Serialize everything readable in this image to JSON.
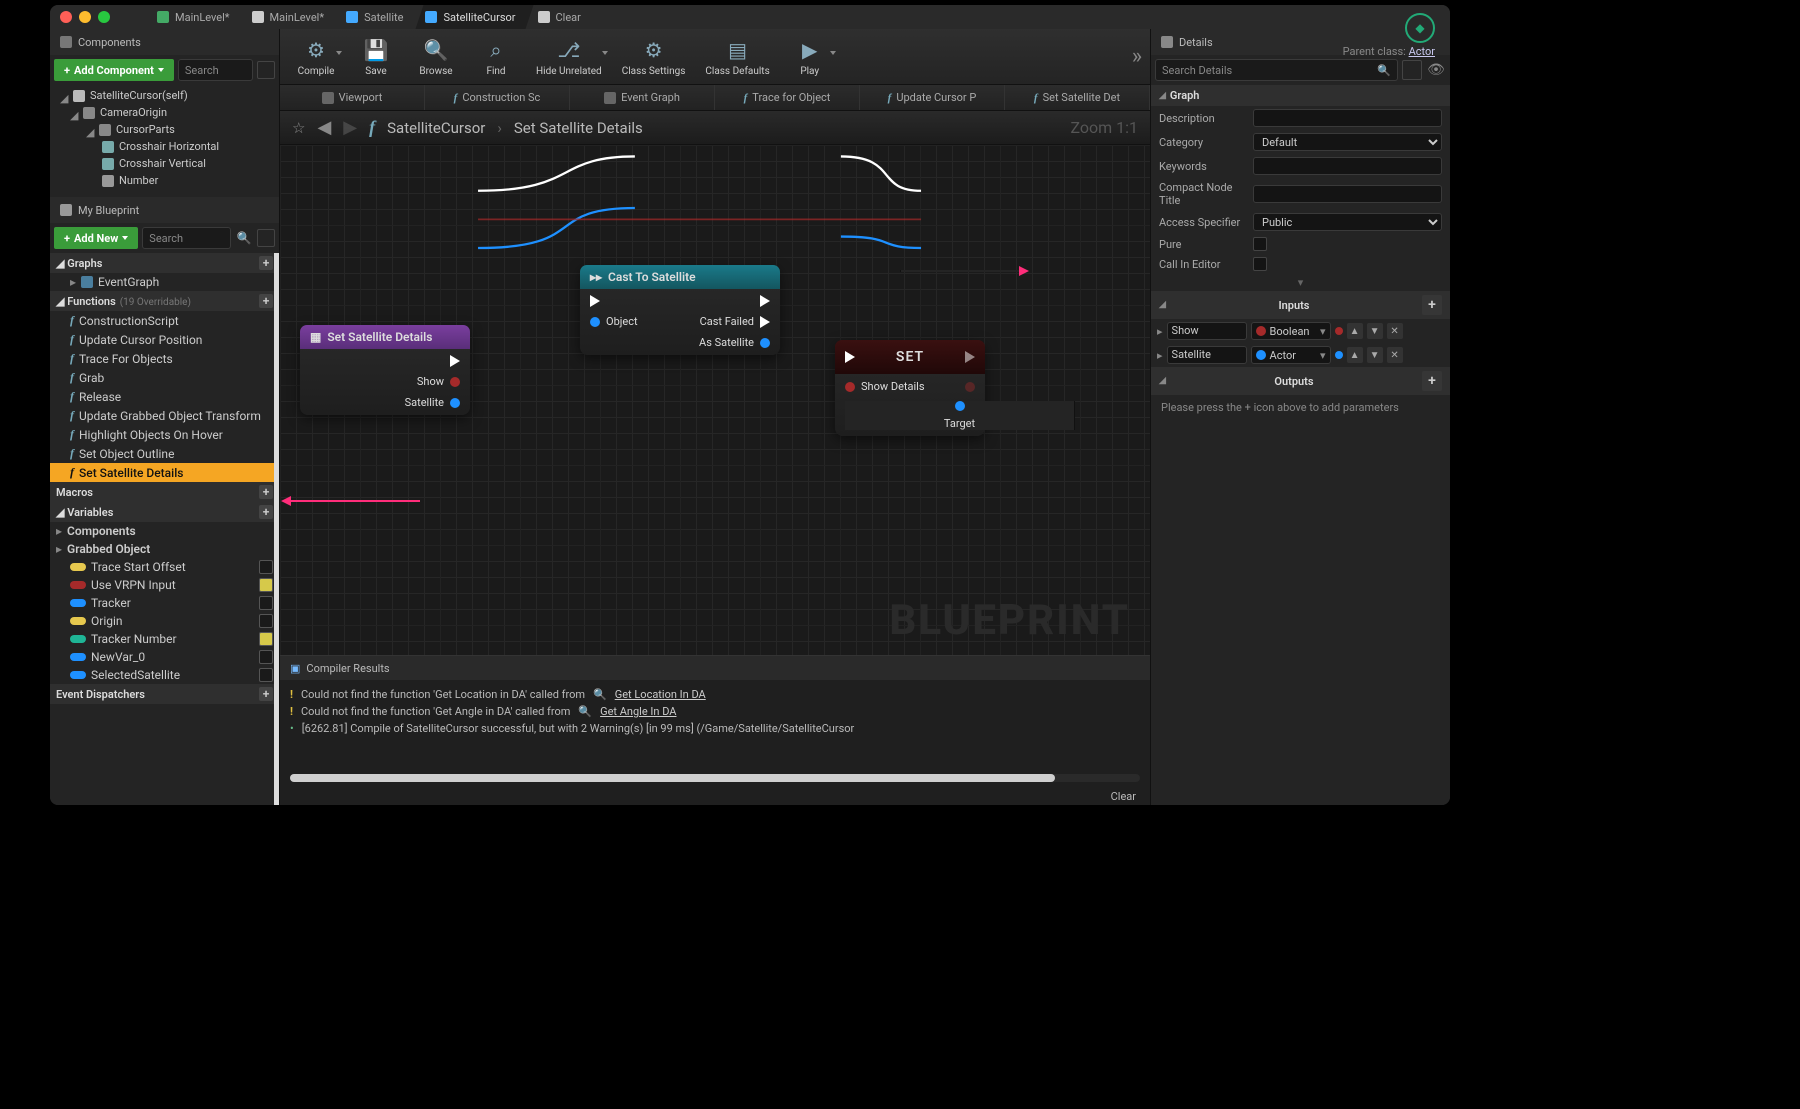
{
  "macos_traffic": [
    "close",
    "minimize",
    "zoom"
  ],
  "doc_tabs": [
    {
      "label": "MainLevel*",
      "active": false,
      "icon": "#4a6"
    },
    {
      "label": "MainLevel*",
      "active": false,
      "icon": "#ccc"
    },
    {
      "label": "Satellite",
      "active": false,
      "icon": "#4af"
    },
    {
      "label": "SatelliteCursor",
      "active": true,
      "icon": "#4af"
    },
    {
      "label": "Clear",
      "active": false,
      "icon": "#ccc"
    }
  ],
  "parent_class_label": "Parent class:",
  "parent_class_value": "Actor",
  "components_panel": {
    "title": "Components",
    "add_label": "Add Component",
    "search_placeholder": "Search",
    "tree": [
      {
        "label": "SatelliteCursor(self)",
        "depth": 0,
        "icon": "#bbb"
      },
      {
        "label": "CameraOrigin",
        "depth": 1,
        "icon": "#888"
      },
      {
        "label": "CursorParts",
        "depth": 2,
        "icon": "#888"
      },
      {
        "label": "Crosshair Horizontal",
        "depth": 3,
        "icon": "#7aa"
      },
      {
        "label": "Crosshair Vertical",
        "depth": 3,
        "icon": "#7aa"
      },
      {
        "label": "Number",
        "depth": 3,
        "icon": "#999"
      }
    ]
  },
  "myblueprint": {
    "title": "My Blueprint",
    "add_label": "Add New",
    "search_placeholder": "Search",
    "graphs_header": "Graphs",
    "graphs": [
      {
        "label": "EventGraph"
      }
    ],
    "functions_header": "Functions",
    "functions_sub": "(19 Overridable)",
    "functions": [
      {
        "label": "ConstructionScript"
      },
      {
        "label": "Update Cursor Position"
      },
      {
        "label": "Trace For Objects"
      },
      {
        "label": "Grab"
      },
      {
        "label": "Release"
      },
      {
        "label": "Update Grabbed Object Transform"
      },
      {
        "label": "Highlight Objects On Hover"
      },
      {
        "label": "Set Object Outline"
      },
      {
        "label": "Set Satellite Details",
        "selected": true
      }
    ],
    "macros_header": "Macros",
    "variables_header": "Variables",
    "var_groups": [
      {
        "label": "Components"
      },
      {
        "label": "Grabbed Object"
      }
    ],
    "variables": [
      {
        "label": "Trace Start Offset",
        "color": "#e6c84e",
        "vis": false
      },
      {
        "label": "Use VRPN Input",
        "color": "#a52a2a",
        "vis": true
      },
      {
        "label": "Tracker",
        "color": "#1e90ff",
        "vis": false
      },
      {
        "label": "Origin",
        "color": "#e6c84e",
        "vis": false
      },
      {
        "label": "Tracker Number",
        "color": "#1fb596",
        "vis": true
      },
      {
        "label": "NewVar_0",
        "color": "#1e90ff",
        "vis": false
      },
      {
        "label": "SelectedSatellite",
        "color": "#1e90ff",
        "vis": false
      }
    ],
    "dispatchers_header": "Event Dispatchers"
  },
  "toolbar": [
    {
      "label": "Compile",
      "icon": "gear-warn",
      "dropdown": true
    },
    {
      "label": "Save",
      "icon": "save"
    },
    {
      "label": "Browse",
      "icon": "search"
    },
    {
      "label": "Find",
      "icon": "find"
    },
    {
      "label": "Hide Unrelated",
      "icon": "branch",
      "dropdown": true
    },
    {
      "label": "Class Settings",
      "icon": "settings"
    },
    {
      "label": "Class Defaults",
      "icon": "defaults"
    },
    {
      "label": "Play",
      "icon": "play",
      "dropdown": true
    }
  ],
  "graph_tabs": [
    {
      "label": "Viewport",
      "icon": "viewport"
    },
    {
      "label": "Construction Sc",
      "icon": "func"
    },
    {
      "label": "Event Graph",
      "icon": "event"
    },
    {
      "label": "Trace for Object",
      "icon": "func"
    },
    {
      "label": "Update Cursor P",
      "icon": "func"
    },
    {
      "label": "Set Satellite Det",
      "icon": "func"
    }
  ],
  "breadcrumb": {
    "parent": "SatelliteCursor",
    "current": "Set Satellite Details",
    "zoom": "Zoom 1:1"
  },
  "canvas": {
    "watermark": "BLUEPRINT",
    "nodes": {
      "entry": {
        "title": "Set Satellite Details",
        "pins_right": [
          {
            "type": "exec",
            "label": ""
          },
          {
            "type": "bool",
            "label": "Show"
          },
          {
            "type": "obj",
            "label": "Satellite"
          }
        ]
      },
      "cast": {
        "title": "Cast To Satellite",
        "pins_left": [
          {
            "type": "exec",
            "label": ""
          },
          {
            "type": "obj",
            "label": "Object"
          }
        ],
        "pins_right": [
          {
            "type": "exec",
            "label": ""
          },
          {
            "type": "exec",
            "label": "Cast Failed"
          },
          {
            "type": "obj",
            "label": "As Satellite"
          }
        ]
      },
      "set": {
        "title": "SET",
        "pins_left": [
          {
            "type": "exec",
            "label": ""
          },
          {
            "type": "bool",
            "label": "Show Details"
          },
          {
            "type": "obj",
            "label": "Target"
          }
        ],
        "pins_right": [
          {
            "type": "exec",
            "label": ""
          },
          {
            "type": "bool",
            "label": ""
          }
        ]
      }
    }
  },
  "compiler": {
    "title": "Compiler Results",
    "lines": [
      {
        "sev": "warn",
        "text": "Could not find the function 'Get Location in DA' called from",
        "link": "Get Location In DA"
      },
      {
        "sev": "warn",
        "text": "Could not find the function 'Get Angle in DA' called from",
        "link": "Get Angle In DA"
      },
      {
        "sev": "info",
        "text": "[6262.81] Compile of SatelliteCursor successful, but with 2 Warning(s) [in 99 ms] (/Game/Satellite/SatelliteCursor"
      }
    ],
    "clear": "Clear"
  },
  "details": {
    "title": "Details",
    "search_placeholder": "Search Details",
    "graph_hdr": "Graph",
    "rows": {
      "description": "Description",
      "category": "Category",
      "category_value": "Default",
      "keywords": "Keywords",
      "compact": "Compact Node Title",
      "access": "Access Specifier",
      "access_value": "Public",
      "pure": "Pure",
      "callineditor": "Call In Editor"
    },
    "inputs_hdr": "Inputs",
    "inputs": [
      {
        "name": "Show",
        "type": "Boolean",
        "color": "#a52a2a"
      },
      {
        "name": "Satellite",
        "type": "Actor",
        "color": "#1e90ff"
      }
    ],
    "outputs_hdr": "Outputs",
    "outputs_hint": "Please press the + icon above to add parameters"
  }
}
